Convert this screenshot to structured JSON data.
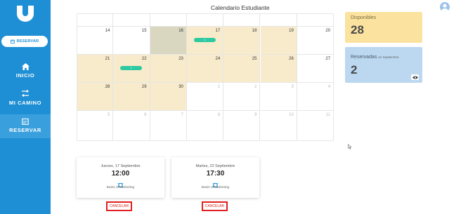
{
  "header": {
    "title": "Calendario Estudiante"
  },
  "sidebar": {
    "reserve_button": "RESERVAR",
    "items": [
      {
        "label": "INICIO",
        "icon": "home-icon"
      },
      {
        "label": "MI CAMINO",
        "icon": "route-icon"
      },
      {
        "label": "RESERVAR",
        "icon": "calendar-icon",
        "active": true
      }
    ]
  },
  "calendar": {
    "weeks": [
      {
        "days": [
          {
            "num": "",
            "state": "blank"
          },
          {
            "num": "",
            "state": "blank"
          },
          {
            "num": "",
            "state": "blank"
          },
          {
            "num": "",
            "state": "blank"
          },
          {
            "num": "",
            "state": "blank"
          },
          {
            "num": "",
            "state": "blank"
          },
          {
            "num": "",
            "state": "blank"
          }
        ]
      },
      {
        "days": [
          {
            "num": "14",
            "state": "normal"
          },
          {
            "num": "15",
            "state": "normal"
          },
          {
            "num": "16",
            "state": "today"
          },
          {
            "num": "17",
            "state": "avail",
            "event": "1"
          },
          {
            "num": "18",
            "state": "avail"
          },
          {
            "num": "19",
            "state": "avail"
          },
          {
            "num": "20",
            "state": "normal"
          }
        ]
      },
      {
        "days": [
          {
            "num": "21",
            "state": "avail"
          },
          {
            "num": "22",
            "state": "avail",
            "event": "1"
          },
          {
            "num": "23",
            "state": "avail"
          },
          {
            "num": "24",
            "state": "avail"
          },
          {
            "num": "25",
            "state": "avail"
          },
          {
            "num": "26",
            "state": "avail"
          },
          {
            "num": "27",
            "state": "normal"
          }
        ]
      },
      {
        "days": [
          {
            "num": "28",
            "state": "avail"
          },
          {
            "num": "29",
            "state": "avail"
          },
          {
            "num": "30",
            "state": "avail"
          },
          {
            "num": "1",
            "state": "other"
          },
          {
            "num": "2",
            "state": "other"
          },
          {
            "num": "3",
            "state": "other"
          },
          {
            "num": "4",
            "state": "other"
          }
        ]
      },
      {
        "days": [
          {
            "num": "5",
            "state": "other"
          },
          {
            "num": "6",
            "state": "other"
          },
          {
            "num": "7",
            "state": "other"
          },
          {
            "num": "8",
            "state": "other"
          },
          {
            "num": "9",
            "state": "other"
          },
          {
            "num": "10",
            "state": "other"
          },
          {
            "num": "11",
            "state": "other"
          }
        ]
      }
    ]
  },
  "stats": {
    "available_label": "Disponibles",
    "available_value": "28",
    "reserved_label": "Reservadas",
    "reserved_sub": "en Septiembre",
    "reserved_value": "2"
  },
  "bookings": [
    {
      "date": "Jueves, 17 Septiembre",
      "time": "12:00",
      "course": "Basis of Marketing",
      "cancel": "CANCELAR"
    },
    {
      "date": "Martes, 22 Septiembre",
      "time": "17:30",
      "course": "Basis of Marketing",
      "cancel": "CANCELAR"
    }
  ],
  "colors": {
    "sidebar": "#1e8fd5",
    "available_day": "#f7ebcc",
    "today": "#d9d7c0",
    "event": "#2cc9a2",
    "cancel": "#e02020",
    "card_yellow": "#fbe39f",
    "card_blue": "#bcd8f1"
  }
}
